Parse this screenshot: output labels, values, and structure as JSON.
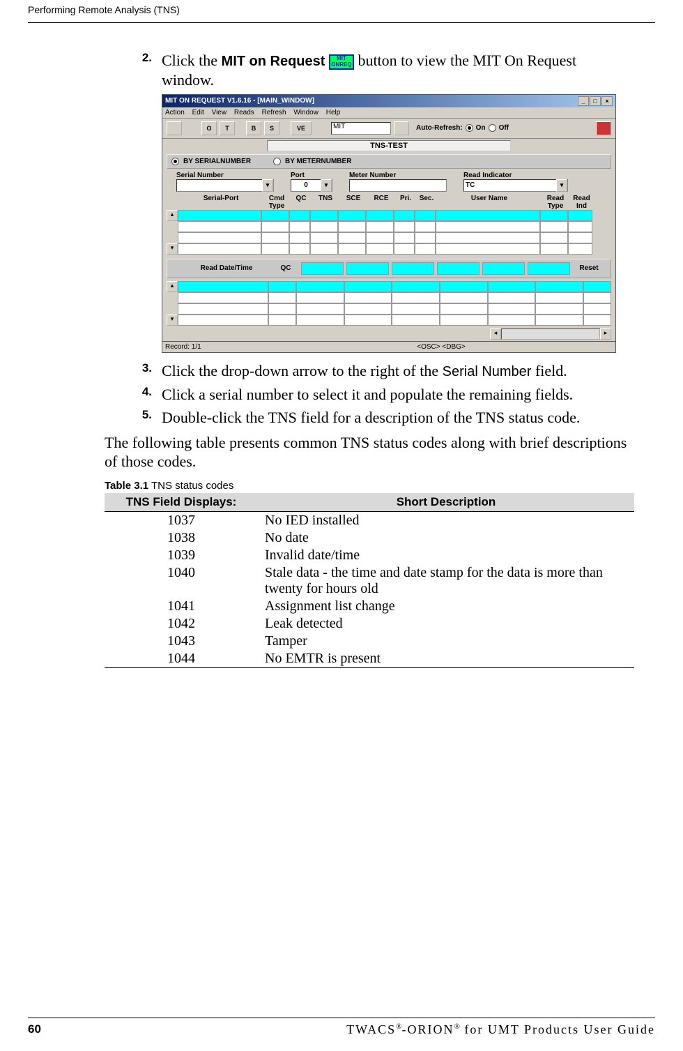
{
  "header": {
    "section_title": "Performing Remote Analysis (TNS)"
  },
  "steps": [
    {
      "num": "2.",
      "pre": "Click the ",
      "bold": "MIT on Request",
      "post_icon": " button to view the MIT On Request window.",
      "icon_text": "MIT\nONREQ"
    },
    {
      "num": "3.",
      "text_prefix": "Click the drop-down arrow to the right of the ",
      "ui_term": "Serial Number",
      "text_suffix": " field."
    },
    {
      "num": "4.",
      "plain": "Click a serial number to select it and populate the remaining fields."
    },
    {
      "num": "5.",
      "plain": "Double-click the TNS field for a description of the TNS status code."
    }
  ],
  "paragraph": "The following table presents common TNS status codes along with brief descriptions of those codes.",
  "table": {
    "caption_bold": "Table 3.1",
    "caption_rest": "   TNS status codes",
    "headers": [
      "TNS Field Displays:",
      "Short Description"
    ],
    "rows": [
      [
        "1037",
        "No IED installed"
      ],
      [
        "1038",
        "No date"
      ],
      [
        "1039",
        "Invalid date/time"
      ],
      [
        "1040",
        "Stale data - the time and date stamp for the data is more than twenty for hours old"
      ],
      [
        "1041",
        "Assignment list change"
      ],
      [
        "1042",
        "Leak detected"
      ],
      [
        "1043",
        "Tamper"
      ],
      [
        "1044",
        "No EMTR is present"
      ]
    ]
  },
  "screenshot": {
    "title": "MIT ON REQUEST V1.6.16 - [MAIN_WINDOW]",
    "menu": [
      "Action",
      "Edit",
      "View",
      "Reads",
      "Refresh",
      "Window",
      "Help"
    ],
    "mit_input": "MIT",
    "toolbar_buttons": [
      "O",
      "T",
      "B",
      "S",
      "VE"
    ],
    "auto_refresh": "Auto-Refresh:",
    "on_label": "On",
    "off_label": "Off",
    "tns_test": "TNS-TEST",
    "by_serial": "BY SERIALNUMBER",
    "by_meter": "BY METERNUMBER",
    "fields": {
      "serial": "Serial Number",
      "port": "Port",
      "port_value": "0",
      "meter": "Meter Number",
      "read_ind": "Read Indicator",
      "read_ind_value": "TC"
    },
    "colheads": {
      "serial_port": "Serial-Port",
      "cmd_type": "Cmd Type",
      "qc": "QC",
      "tns": "TNS",
      "sce": "SCE",
      "rce": "RCE",
      "pri": "Pri.",
      "sec": "Sec.",
      "user_name": "User Name",
      "read_type": "Read Type",
      "read_ind": "Read Ind"
    },
    "lower": {
      "read_date": "Read Date/Time",
      "qc": "QC",
      "reset": "Reset"
    },
    "status": {
      "record": "Record: 1/1",
      "tags": "<OSC> <DBG>"
    }
  },
  "footer": {
    "page": "60",
    "guide": "TWACS®-ORION® for UMT Products User Guide"
  }
}
